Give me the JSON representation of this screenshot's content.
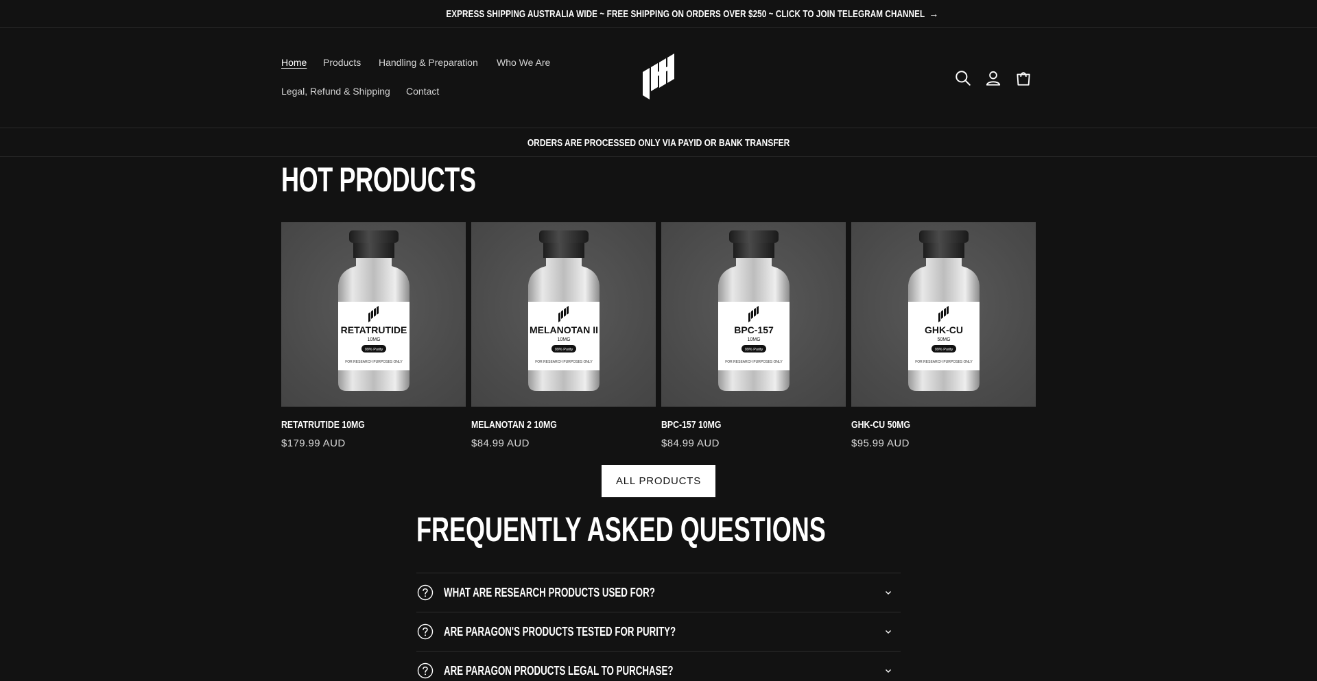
{
  "announcement": {
    "text": "EXPRESS SHIPPING AUSTRALIA WIDE ~ FREE SHIPPING ON ORDERS OVER $250 ~ CLICK TO JOIN TELEGRAM CHANNEL",
    "arrow": "→"
  },
  "nav": {
    "items": [
      {
        "label": "Home"
      },
      {
        "label": "Products"
      },
      {
        "label": "Handling & Preparation"
      },
      {
        "label": "Who We Are"
      },
      {
        "label": "Legal, Refund & Shipping"
      },
      {
        "label": "Contact"
      }
    ]
  },
  "header_icons": [
    "search-icon",
    "account-icon",
    "cart-icon"
  ],
  "processed_bar": {
    "text": "ORDERS ARE PROCESSED ONLY VIA PAYID OR BANK TRANSFER"
  },
  "hot_products": {
    "title": "HOT PRODUCTS",
    "products": [
      {
        "name": "RETATRUTIDE 10MG",
        "price": "$179.99 AUD",
        "label_name": "RETATRUTIDE",
        "label_dose": "10MG"
      },
      {
        "name": "MELANOTAN 2 10MG",
        "price": "$84.99 AUD",
        "label_name": "MELANOTAN II",
        "label_dose": "10MG"
      },
      {
        "name": "BPC-157 10MG",
        "price": "$84.99 AUD",
        "label_name": "BPC-157",
        "label_dose": "10MG"
      },
      {
        "name": "GHK-CU 50MG",
        "price": "$95.99 AUD",
        "label_name": "GHK-CU",
        "label_dose": "50MG"
      }
    ],
    "label_purity": "99% Purity",
    "label_footer": "FOR RESEARCH PURPOSES ONLY",
    "button_label": "ALL PRODUCTS"
  },
  "faq": {
    "title": "FREQUENTLY ASKED QUESTIONS",
    "questions": [
      {
        "q": "WHAT ARE RESEARCH PRODUCTS USED FOR?"
      },
      {
        "q": "ARE PARAGON'S PRODUCTS TESTED FOR PURITY?"
      },
      {
        "q": "ARE PARAGON PRODUCTS LEGAL TO PURCHASE?"
      }
    ]
  },
  "colors": {
    "background": "#121212",
    "text": "#ffffff",
    "card_bg": "#4e4e4e",
    "button_bg": "#ffffff"
  }
}
